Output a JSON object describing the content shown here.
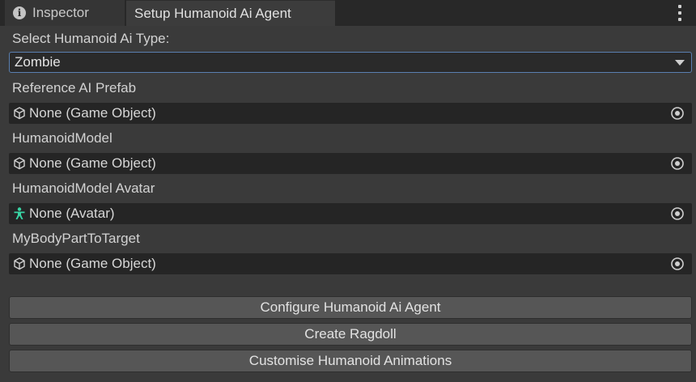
{
  "tabs": [
    {
      "label": "Inspector",
      "icon": "info-icon"
    },
    {
      "label": "Setup Humanoid Ai Agent"
    }
  ],
  "form": {
    "type_label": "Select Humanoid Ai Type:",
    "type_value": "Zombie",
    "fields": [
      {
        "label": "Reference AI Prefab",
        "value": "None (Game Object)",
        "icon": "cube-icon"
      },
      {
        "label": "HumanoidModel",
        "value": "None (Game Object)",
        "icon": "cube-icon"
      },
      {
        "label": "HumanoidModel Avatar",
        "value": "None (Avatar)",
        "icon": "avatar-icon"
      },
      {
        "label": "MyBodyPartToTarget",
        "value": "None (Game Object)",
        "icon": "cube-icon"
      }
    ]
  },
  "buttons": {
    "configure": "Configure Humanoid Ai Agent",
    "ragdoll": "Create Ragdoll",
    "animations": "Customise Humanoid Animations"
  },
  "colors": {
    "focus_border": "#5a7fb0",
    "avatar_icon": "#39d4a4"
  }
}
